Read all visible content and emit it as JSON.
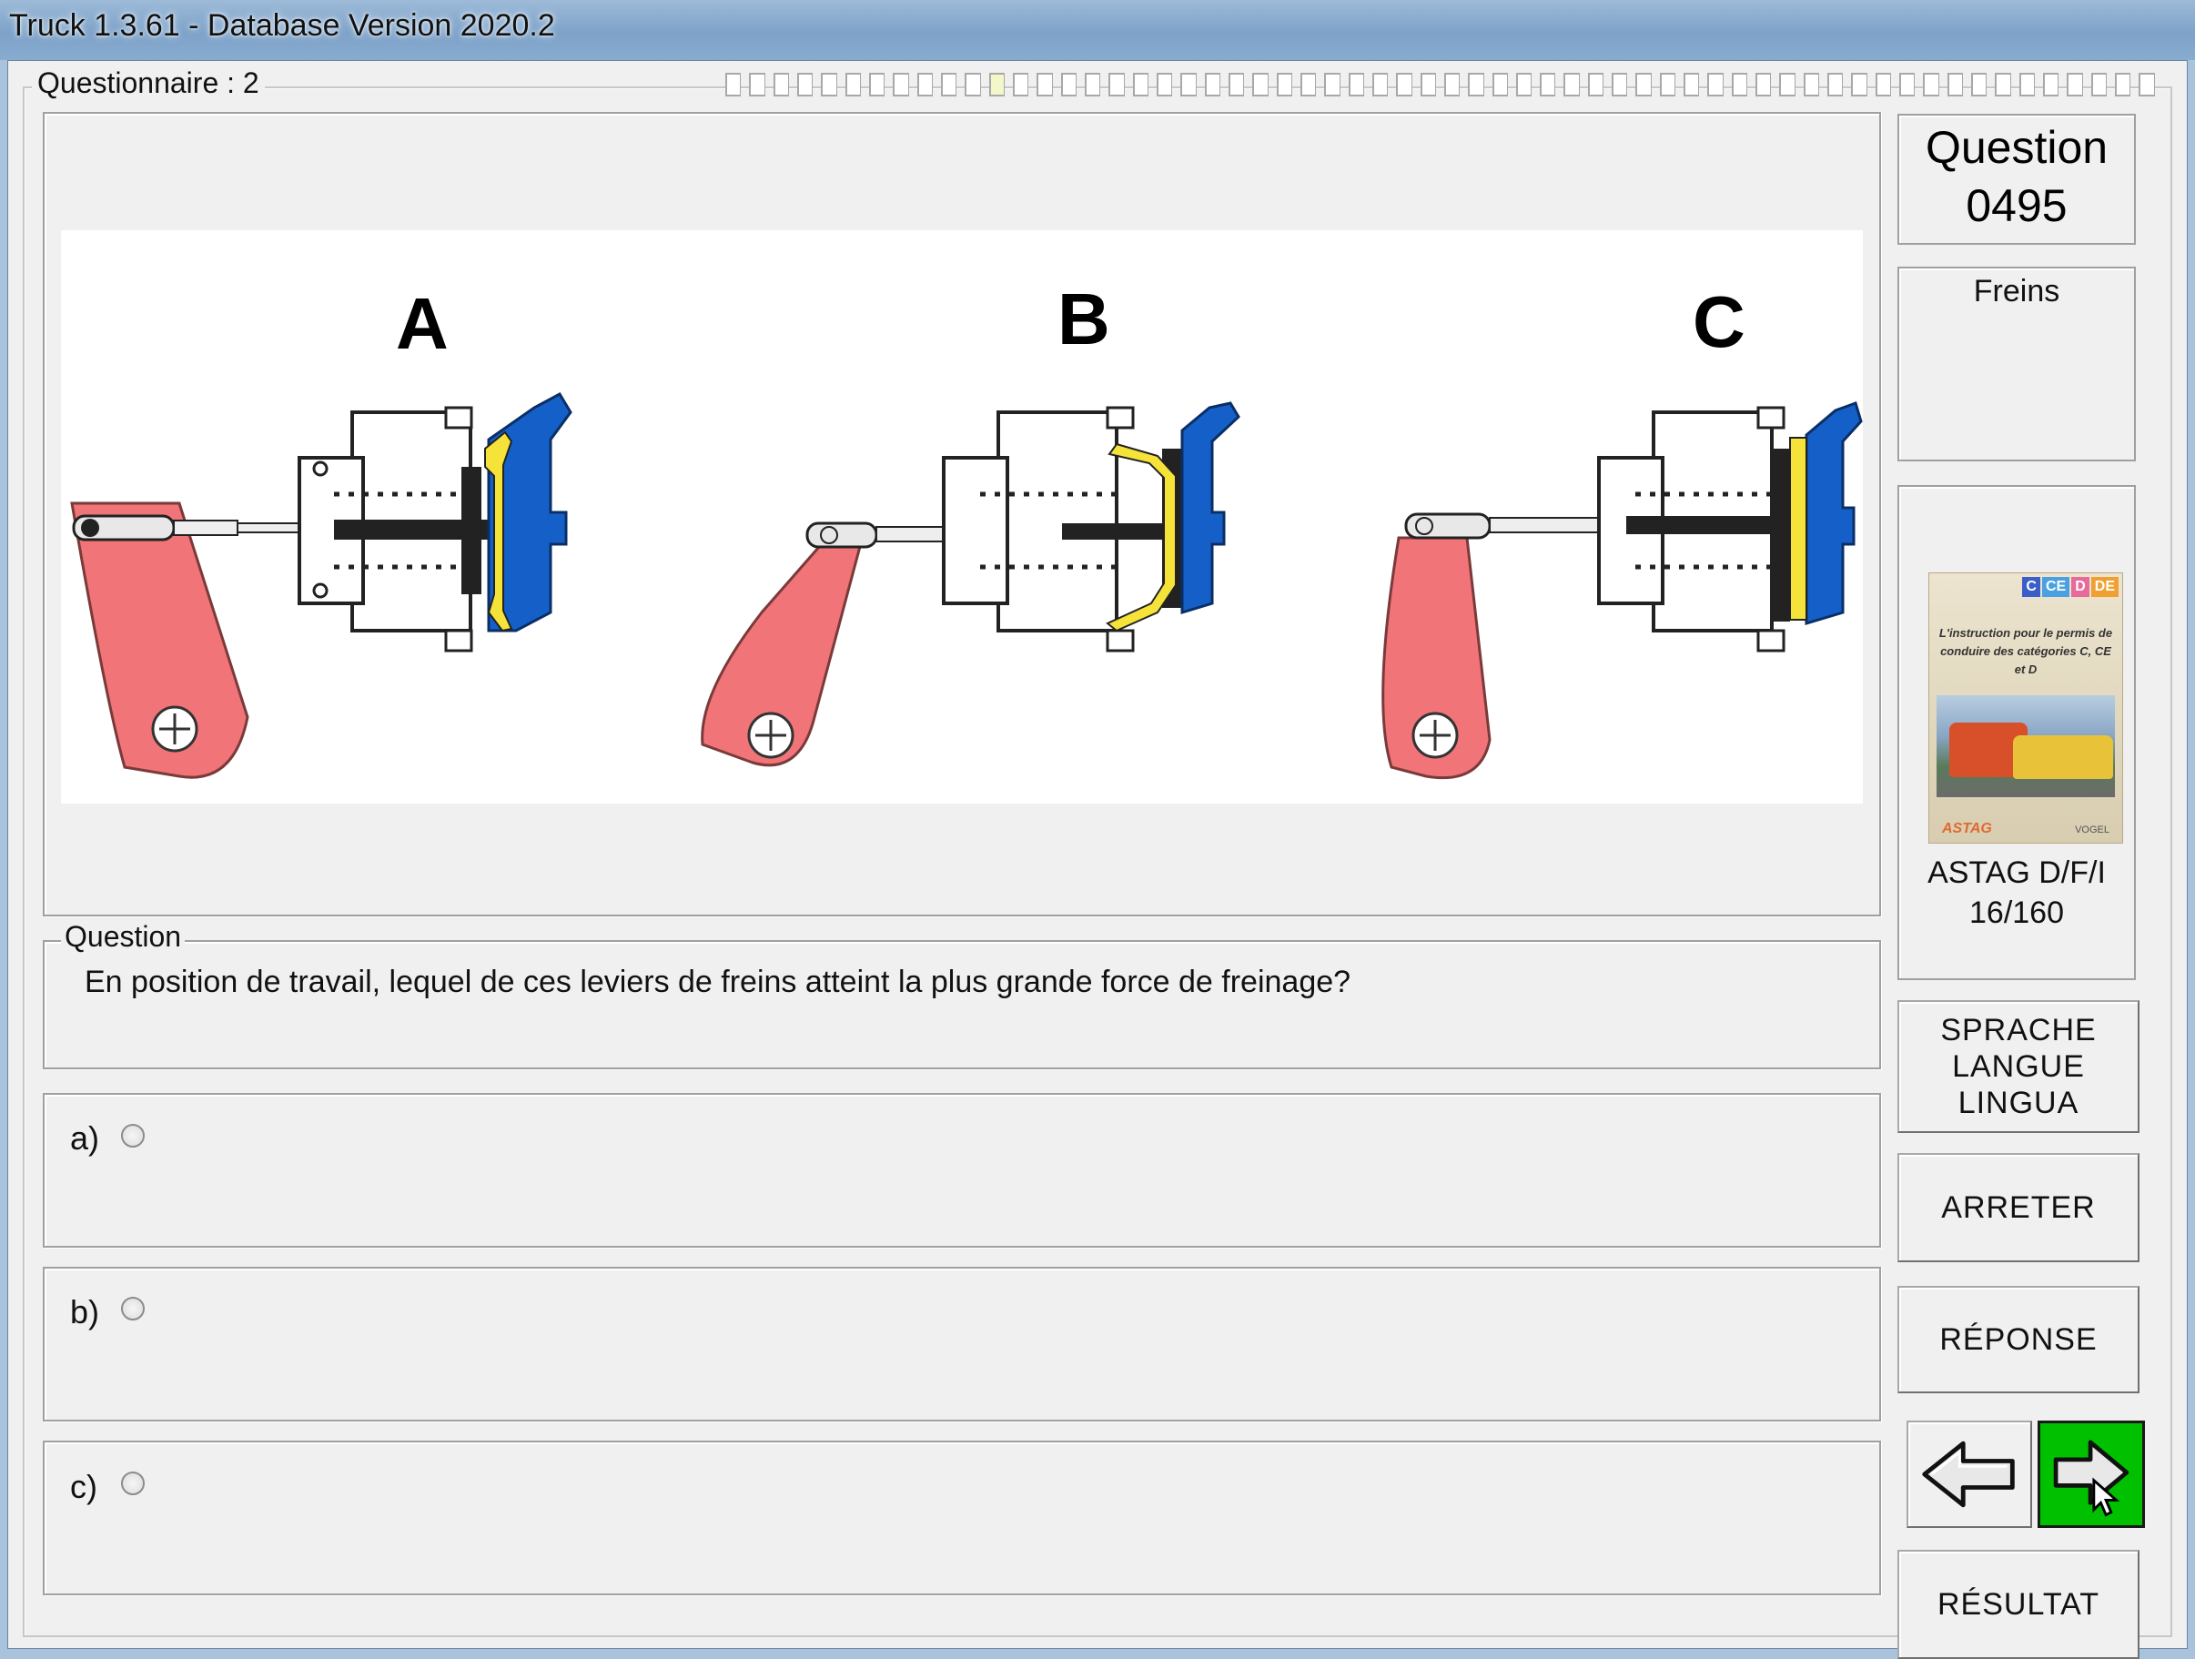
{
  "window": {
    "title": "Truck 1.3.61 - Database Version 2020.2"
  },
  "questionnaire": {
    "label": "Questionnaire : 2",
    "progress_total": 60,
    "progress_current": 11
  },
  "figure": {
    "labels": [
      "A",
      "B",
      "C"
    ]
  },
  "question_box": {
    "legend": "Question",
    "text": "En position de travail, lequel de ces leviers de freins atteint la plus grande force de freinage?"
  },
  "answers": [
    {
      "label": "a)",
      "selected": false
    },
    {
      "label": "b)",
      "selected": false
    },
    {
      "label": "c)",
      "selected": false
    }
  ],
  "sidebar": {
    "question_title": "Question",
    "question_number": "0495",
    "category": "Freins",
    "book": {
      "tabs": [
        "C",
        "CE",
        "D",
        "DE"
      ],
      "subtitle": "L'instruction pour le permis de conduire des catégories C, CE et D",
      "logo_left": "ASTAG",
      "logo_right": "VOGEL"
    },
    "source_line1": "ASTAG D/F/I",
    "source_line2": "16/160"
  },
  "buttons": {
    "language": [
      "SPRACHE",
      "LANGUE",
      "LINGUA"
    ],
    "stop": "ARRETER",
    "answer": "RÉPONSE",
    "result": "RÉSULTAT"
  },
  "colors": {
    "lever": "#f07478",
    "chamber": "#1560c8",
    "diaphragm": "#f5e33a",
    "next_button": "#00c000"
  }
}
